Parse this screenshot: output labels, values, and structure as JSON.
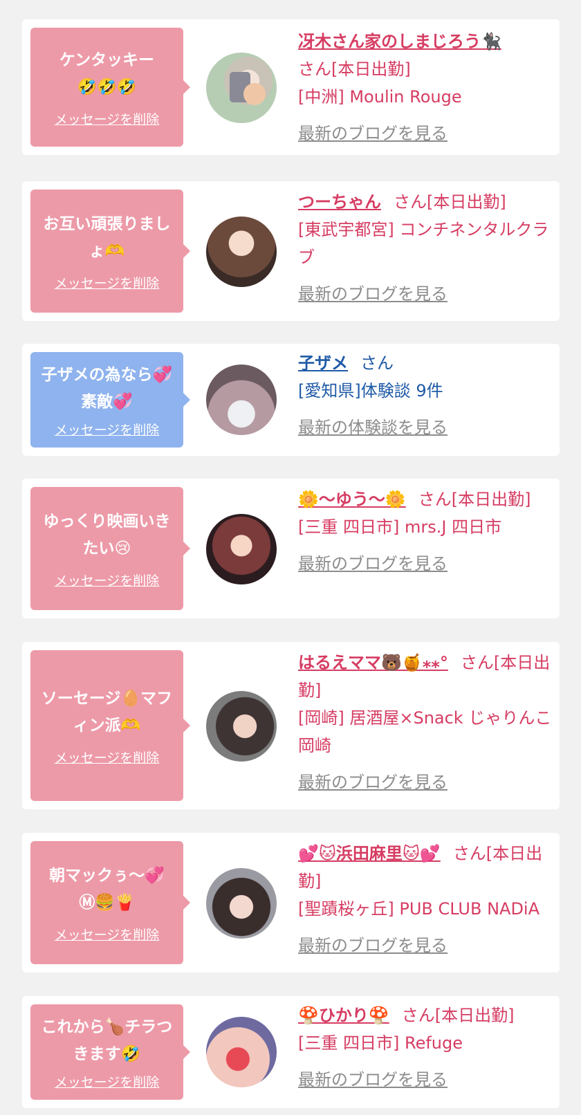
{
  "delete_label": "メッセージを削除",
  "san_label": "さん",
  "cards": [
    {
      "message": "ケンタッキー🤣🤣🤣",
      "name": "冴木さん家のしまじろう🐈‍⬛",
      "status": "さん[本日出勤]",
      "shop": "[中洲] Moulin Rouge",
      "link": "最新のブログを見る"
    },
    {
      "message": "お互い頑張りましょ🫶",
      "name": "つーちゃん",
      "status": "さん[本日出勤]",
      "shop": "[東武宇都宮] コンチネンタルクラブ",
      "link": "最新のブログを見る"
    },
    {
      "message": "子ザメの為なら💞素敵💞",
      "name": "子ザメ",
      "status": "さん",
      "shop": "[愛知県]体験談 9件",
      "link": "最新の体験談を見る"
    },
    {
      "message": "ゆっくり映画いきたい😢",
      "name": "🌼〜ゆう〜🌼",
      "status": "さん[本日出勤]",
      "shop": "[三重 四日市] mrs.J 四日市",
      "link": "最新のブログを見る"
    },
    {
      "message": "ソーセージ🥚マフィン派🫶",
      "name": "はるえママ🐻🍯⁎⁎°",
      "status": "さん[本日出勤]",
      "shop": "[岡崎] 居酒屋×Snack じゃりんこ岡崎",
      "link": "最新のブログを見る"
    },
    {
      "message": "朝マックぅ〜💞Ⓜ🍔🍟",
      "name": "💕🐱浜田麻里🐱💕",
      "status": "さん[本日出勤]",
      "shop": "[聖蹟桜ヶ丘] PUB CLUB NADiA",
      "link": "最新のブログを見る"
    },
    {
      "message": "これから🍗チラつきます🤣",
      "name": "🍄ひかり🍄",
      "status": "さん[本日出勤]",
      "shop": "[三重 四日市] Refuge",
      "link": "最新のブログを見る"
    }
  ]
}
